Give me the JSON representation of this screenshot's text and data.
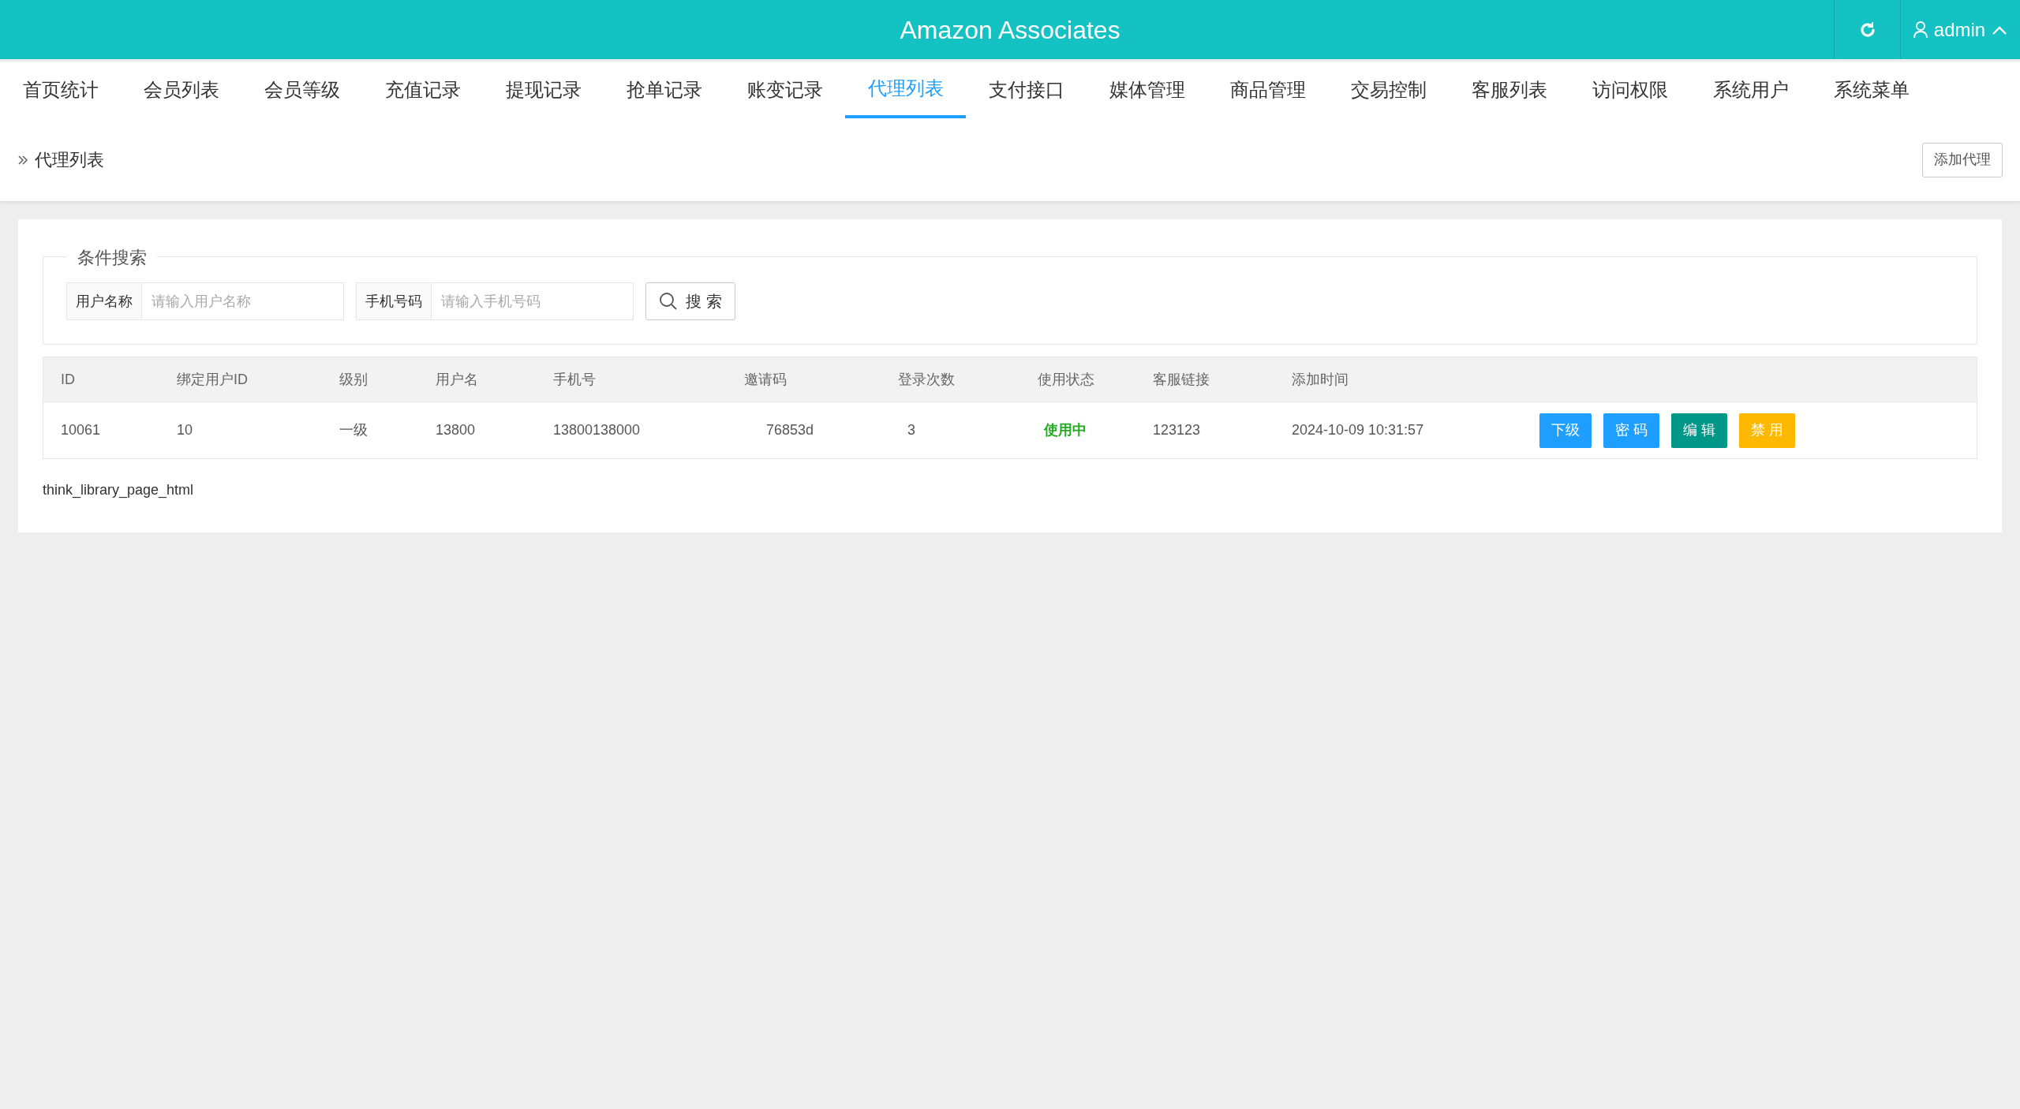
{
  "header": {
    "title": "Amazon Associates",
    "user": "admin"
  },
  "nav": [
    {
      "label": "首页统计",
      "selected": false
    },
    {
      "label": "会员列表",
      "selected": false
    },
    {
      "label": "会员等级",
      "selected": false
    },
    {
      "label": "充值记录",
      "selected": false
    },
    {
      "label": "提现记录",
      "selected": false
    },
    {
      "label": "抢单记录",
      "selected": false
    },
    {
      "label": "账变记录",
      "selected": false
    },
    {
      "label": "代理列表",
      "selected": true
    },
    {
      "label": "支付接口",
      "selected": false
    },
    {
      "label": "媒体管理",
      "selected": false
    },
    {
      "label": "商品管理",
      "selected": false
    },
    {
      "label": "交易控制",
      "selected": false
    },
    {
      "label": "客服列表",
      "selected": false
    },
    {
      "label": "访问权限",
      "selected": false
    },
    {
      "label": "系统用户",
      "selected": false
    },
    {
      "label": "系统菜单",
      "selected": false
    }
  ],
  "breadcrumb": "代理列表",
  "add_button": "添加代理",
  "search": {
    "legend": "条件搜索",
    "fields": [
      {
        "label": "用户名称",
        "placeholder": "请输入用户名称"
      },
      {
        "label": "手机号码",
        "placeholder": "请输入手机号码"
      }
    ],
    "button": "搜 索"
  },
  "table": {
    "columns": [
      "ID",
      "绑定用户ID",
      "级别",
      "用户名",
      "手机号",
      "邀请码",
      "登录次数",
      "使用状态",
      "客服链接",
      "添加时间"
    ],
    "rows": [
      {
        "cells": [
          "10061",
          "10",
          "一级",
          "13800",
          "13800138000",
          "76853d",
          "3",
          "使用中",
          "123123",
          "2024-10-09 10:31:57"
        ],
        "actions": [
          {
            "label": "下级",
            "color": "#1e9fff"
          },
          {
            "label": "密 码",
            "color": "#1e9fff"
          },
          {
            "label": "编 辑",
            "color": "#009688"
          },
          {
            "label": "禁 用",
            "color": "#ffb800"
          }
        ]
      }
    ]
  },
  "pagination": "think_library_page_html"
}
